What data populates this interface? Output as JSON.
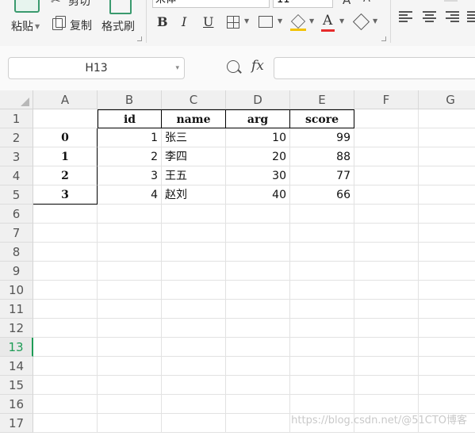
{
  "ribbon": {
    "paste_label": "粘贴",
    "cut_label": "剪切",
    "copy_label": "复制",
    "format_painter_label": "格式刷",
    "font_name": "宋体",
    "font_size": "11",
    "bold_label": "B",
    "italic_label": "I",
    "underline_label": "U",
    "font_color_label": "A",
    "fill_color": "#f2c200",
    "font_color": "#e62b2b"
  },
  "formula_bar": {
    "name_box": "H13",
    "fx_label": "fx",
    "formula": ""
  },
  "sheet": {
    "columns": [
      "A",
      "B",
      "C",
      "D",
      "E",
      "F",
      "G"
    ],
    "rows": [
      "1",
      "2",
      "3",
      "4",
      "5",
      "6",
      "7",
      "8",
      "9",
      "10",
      "11",
      "12",
      "13",
      "14",
      "15",
      "16",
      "17"
    ],
    "active_row": "13",
    "cells": {
      "B1": "id",
      "C1": "name",
      "D1": "arg",
      "E1": "score",
      "A2": "0",
      "B2": "1",
      "C2": "张三",
      "D2": "10",
      "E2": "99",
      "A3": "1",
      "B3": "2",
      "C3": "李四",
      "D3": "20",
      "E3": "88",
      "A4": "2",
      "B4": "3",
      "C4": "王五",
      "D4": "30",
      "E4": "77",
      "A5": "3",
      "B5": "4",
      "C5": "赵刘",
      "D5": "40",
      "E5": "66"
    },
    "accent_color": "#1e9c56"
  },
  "watermark": "https://blog.csdn.net/@51CTO博客"
}
